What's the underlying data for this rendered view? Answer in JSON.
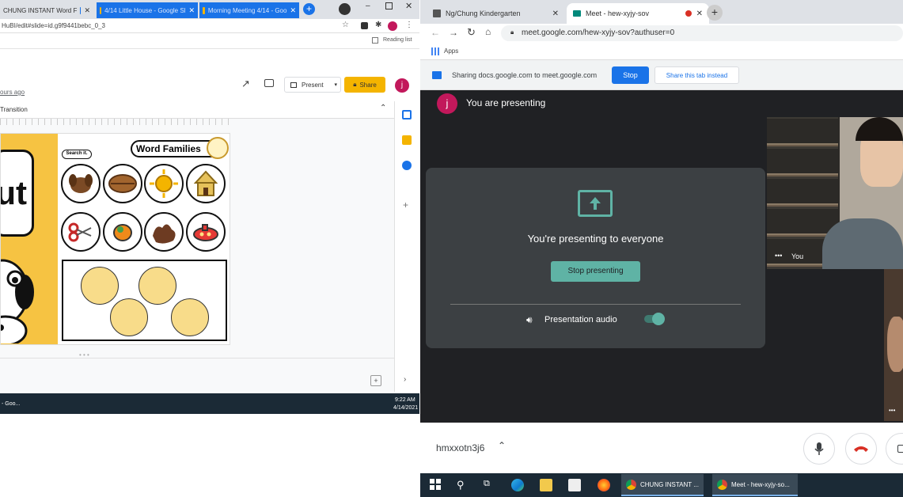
{
  "left_browser": {
    "tabs": [
      {
        "label": "CHUNG INSTANT Word F"
      },
      {
        "label": "4/14 Little House - Google Sl"
      },
      {
        "label": "Morning Meeting 4/14 - Goo"
      }
    ],
    "url": "HuBI/edit#slide=id.g9f9441bebc_0_3",
    "reading_list": "Reading list",
    "last_edit": "ours ago",
    "present_label": "Present",
    "share_label": "Share",
    "avatar_letter": "j",
    "transition_label": "Transition",
    "slide": {
      "big_text": "ut",
      "search_label": "Search it.",
      "title": "Word Families"
    }
  },
  "left_taskbar": {
    "app_label": "- Goo...",
    "time": "9:22 AM",
    "date": "4/14/2021"
  },
  "right_browser": {
    "tabs": [
      {
        "label": "Ng/Chung Kindergarten"
      },
      {
        "label": "Meet - hew-xyjy-sov"
      }
    ],
    "url": "meet.google.com/hew-xyjy-sov?authuser=0",
    "apps_label": "Apps",
    "sharing_text": "Sharing docs.google.com to meet.google.com",
    "stop_label": "Stop",
    "share_tab_label": "Share this tab instead"
  },
  "meet": {
    "avatar_letter": "j",
    "presenting_title": "You are presenting",
    "card_text": "You're presenting to everyone",
    "stop_presenting_label": "Stop presenting",
    "presentation_audio_label": "Presentation audio",
    "self_tile_label": "You",
    "meeting_code": "hmxxotn3j6"
  },
  "right_taskbar": {
    "apps": [
      {
        "label": "CHUNG INSTANT ..."
      },
      {
        "label": "Meet - hew-xyjy-so..."
      }
    ]
  },
  "colors": {
    "meet_teal": "#5fb3a5",
    "slide_yellow": "#f6c342",
    "share_btn": "#f4b400",
    "chrome_blue": "#1a73e8",
    "hangup_red": "#d93025"
  },
  "icons": [
    "search-icon",
    "gear-icon",
    "present-screen-icon",
    "microphone-icon",
    "hangup-icon",
    "volume-icon",
    "windows-start-icon"
  ]
}
